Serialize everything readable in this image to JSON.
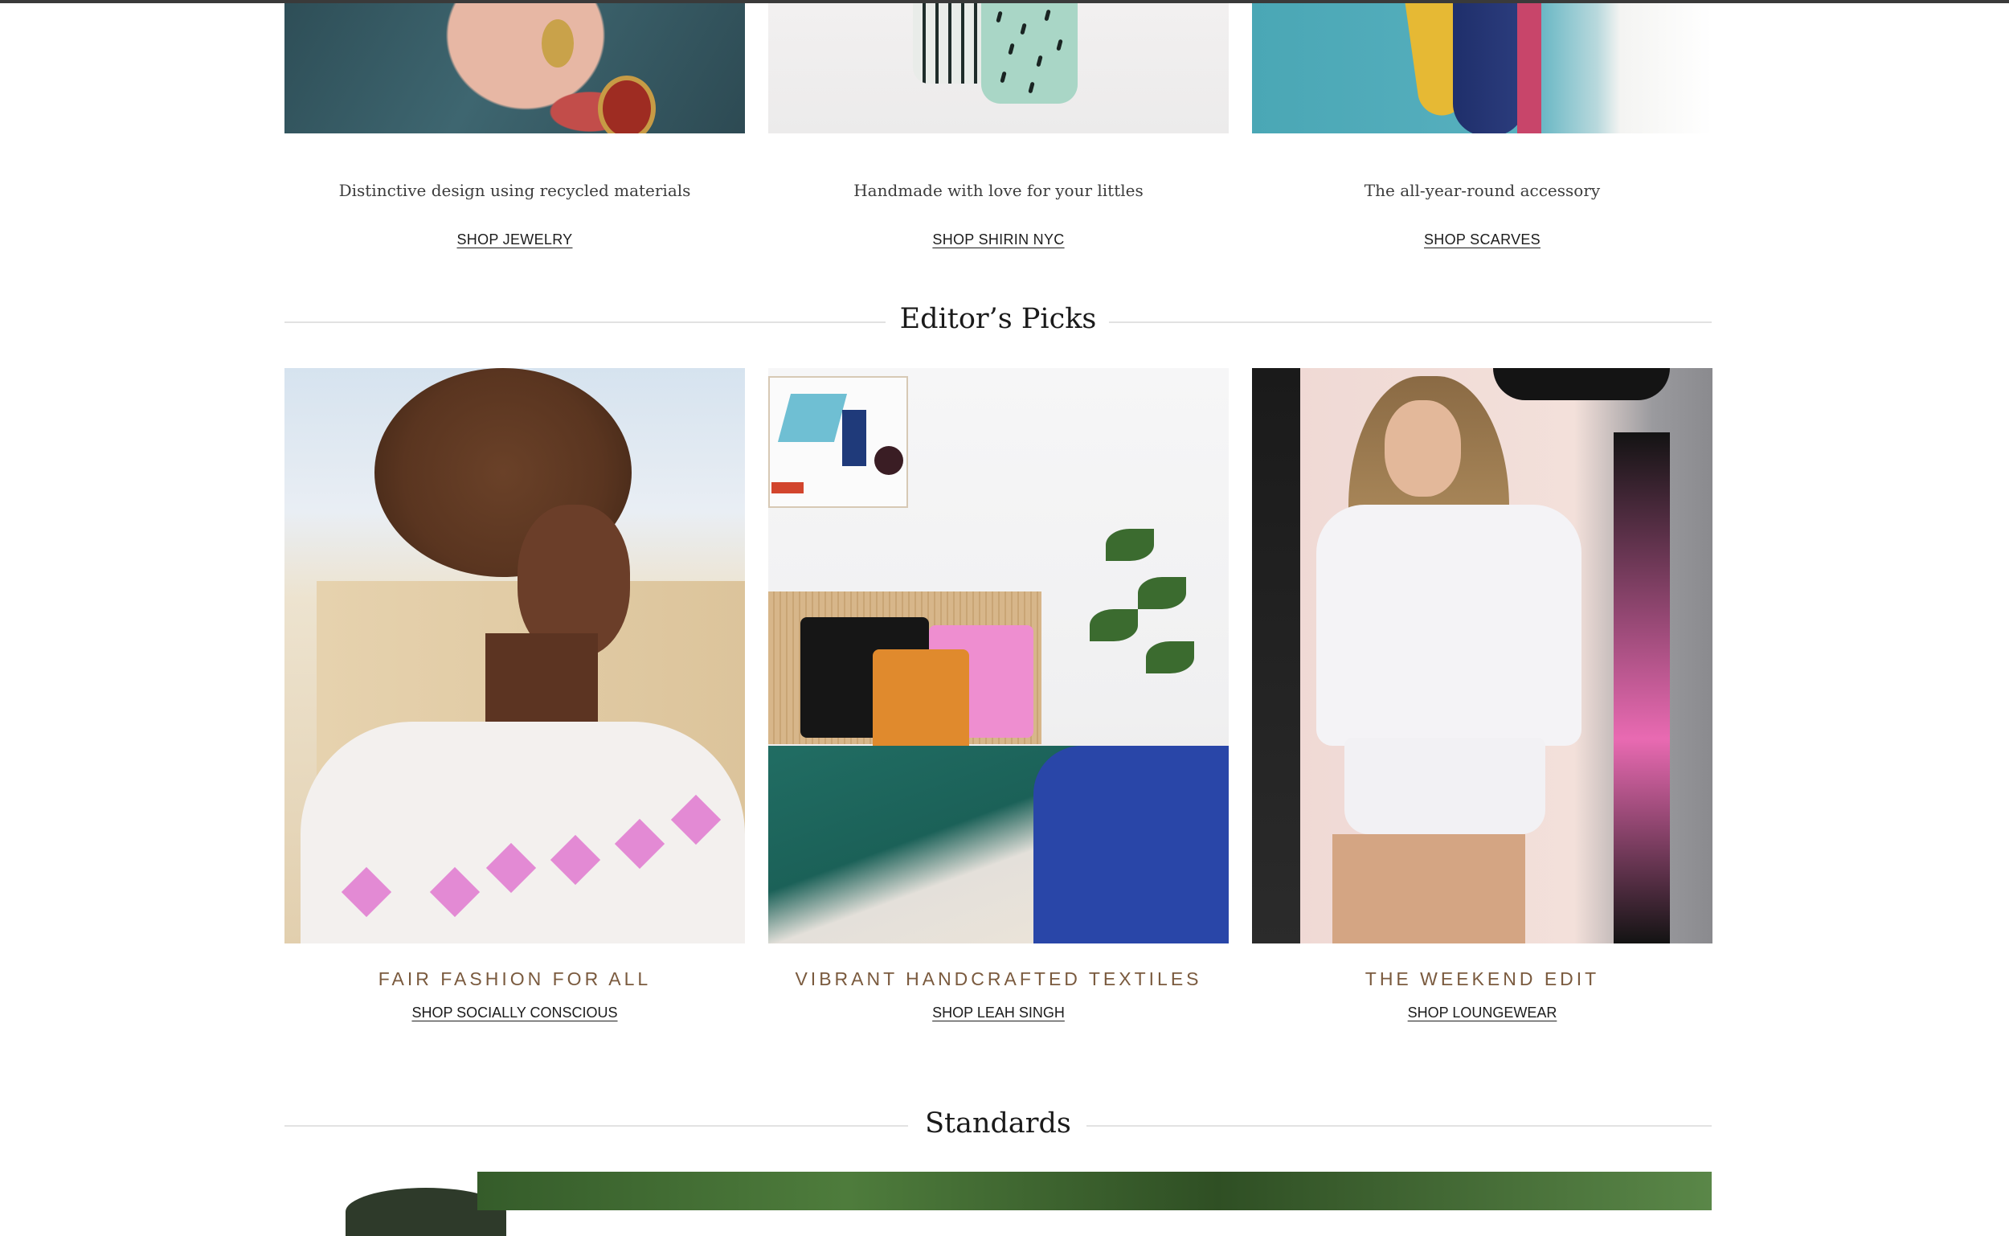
{
  "row1": [
    {
      "tagline": "Distinctive design using recycled materials",
      "link": "SHOP JEWELRY"
    },
    {
      "tagline": "Handmade with love for your littles",
      "link": "SHOP SHIRIN NYC"
    },
    {
      "tagline": "The all-year-round accessory",
      "link": "SHOP SCARVES"
    }
  ],
  "editors": {
    "heading": "Editor’s Picks",
    "items": [
      {
        "title": "FAIR FASHION FOR ALL",
        "link": "SHOP SOCIALLY CONSCIOUS"
      },
      {
        "title": "VIBRANT HANDCRAFTED TEXTILES",
        "link": "SHOP LEAH SINGH"
      },
      {
        "title": "THE WEEKEND EDIT",
        "link": "SHOP LOUNGEWEAR"
      }
    ]
  },
  "standards": {
    "heading": "Standards"
  },
  "colors": {
    "accent": "#7a5a3e",
    "rule": "#e2e2e2",
    "text": "#1c1c1c"
  }
}
